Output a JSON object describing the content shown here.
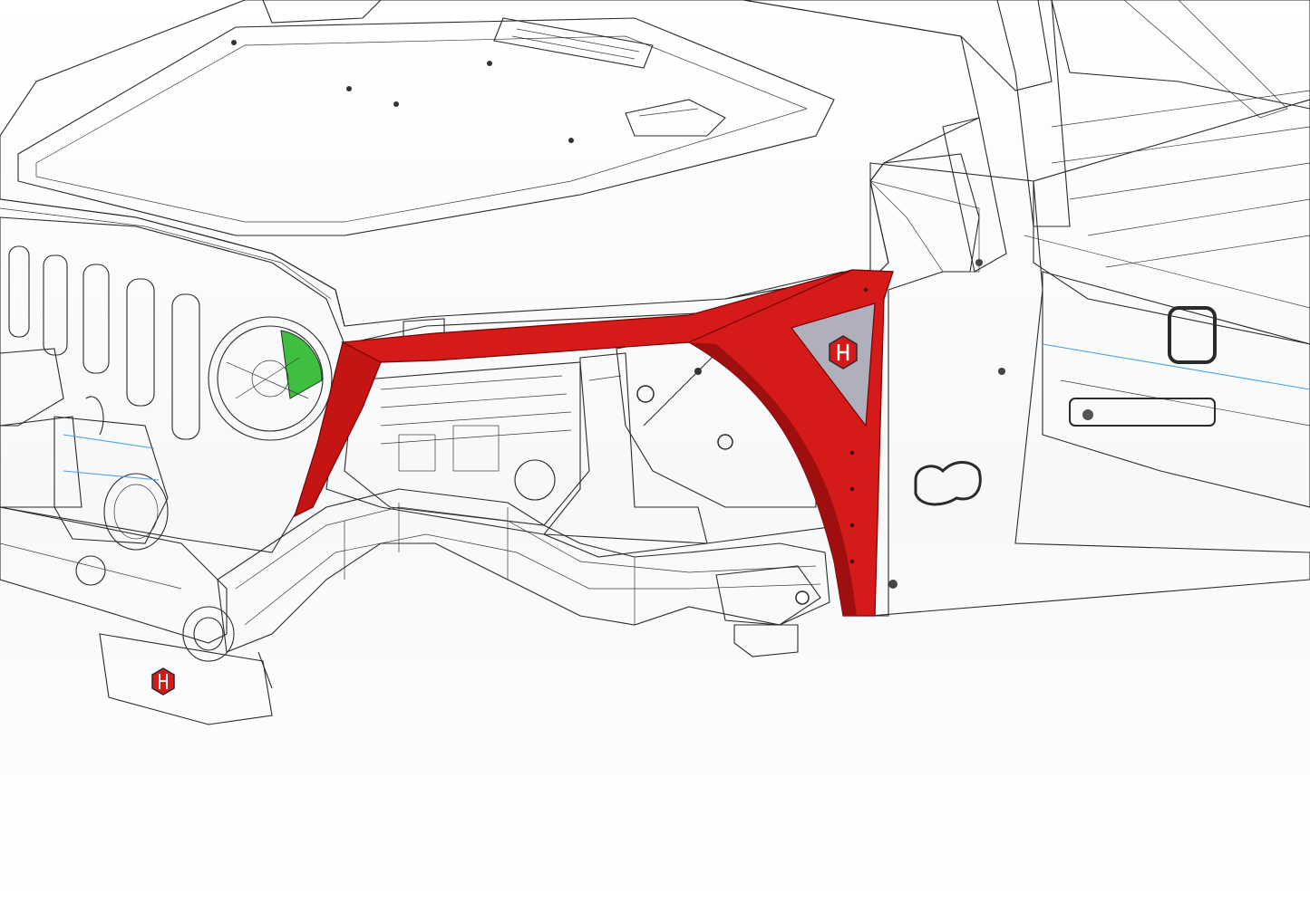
{
  "scene": {
    "colors": {
      "body_gray": "#8c8c8c",
      "body_gray_light": "#a3a3a3",
      "body_gray_dark": "#6e6e6e",
      "frame_lavender": "#b8b8d2",
      "frame_lavender_dark": "#9a9ab8",
      "fender_brace_red": "#d51a1a",
      "fender_brace_red_dark": "#a00f0f",
      "transmission_teal": "#1f9a8a",
      "winch_blue": "#2f8fd0",
      "winch_orange": "#d5722c",
      "headlight_green": "#3fbf3f",
      "edge_line": "#2a2a2a"
    },
    "icons": [
      "logo-hex-h-icon",
      "logo-hex-h-icon-skid",
      "jeep-emblem-icon"
    ]
  }
}
